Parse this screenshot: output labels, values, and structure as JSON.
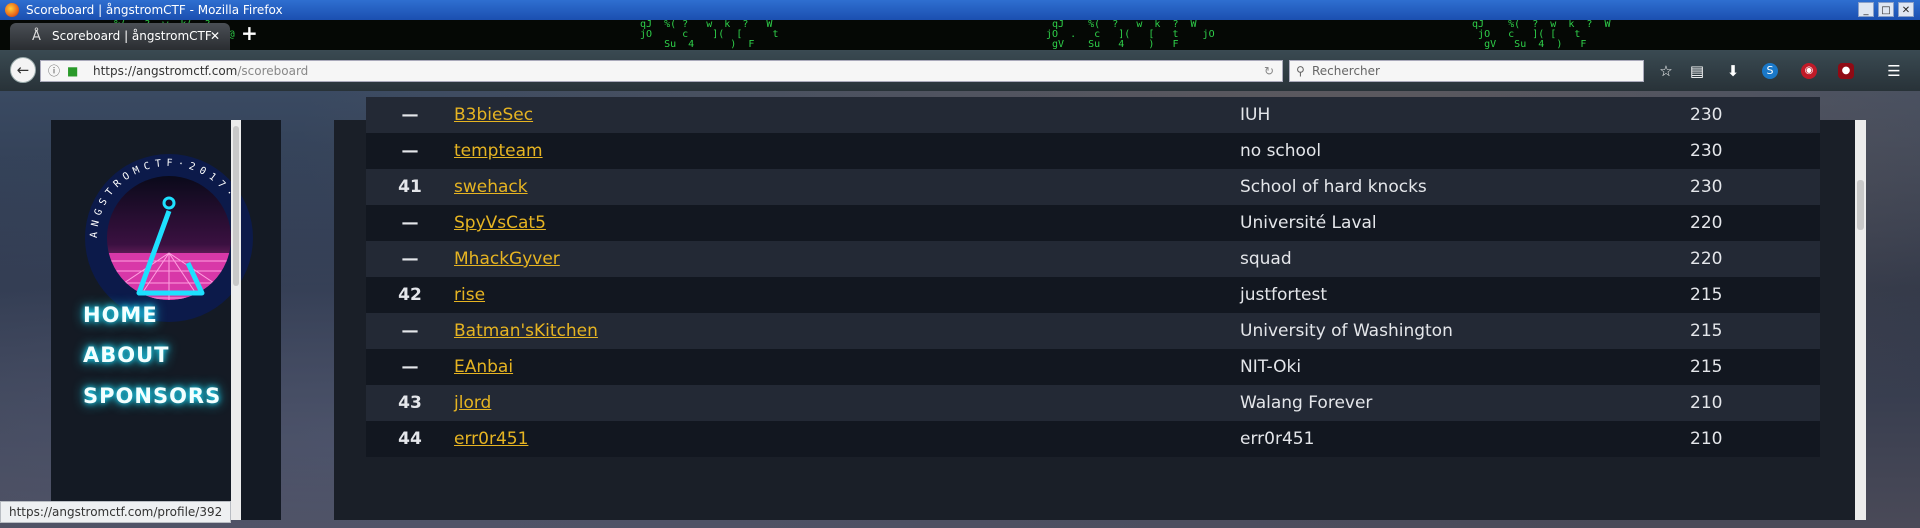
{
  "window": {
    "title": "Scoreboard | ångstromCTF - Mozilla Firefox",
    "controls": [
      "_",
      "□",
      "✕"
    ]
  },
  "tab": {
    "title": "Scoreboard | ångstromCTF",
    "favicon": "Å",
    "close": "✕",
    "new_tab": "+"
  },
  "navbar": {
    "back_icon": "arrow-left-icon",
    "url_domain": "https://angstromctf.com",
    "url_path": "/scoreboard",
    "search_placeholder": "Rechercher",
    "toolbar_icons": [
      "star-icon",
      "reading-list-icon",
      "download-icon",
      "skype-icon",
      "extension-icon",
      "ublock-icon",
      "menu-icon"
    ]
  },
  "sidebar": {
    "logo_text": "ANGSTROMCTF·2017·",
    "logo_glyph": "Å",
    "nav": [
      "HOME",
      "ABOUT",
      "SPONSORS"
    ]
  },
  "scoreboard": {
    "rows": [
      {
        "rank": "—",
        "team": "B3bieSec",
        "school": "IUH",
        "points": "230"
      },
      {
        "rank": "—",
        "team": "tempteam",
        "school": "no school",
        "points": "230"
      },
      {
        "rank": "41",
        "team": "swehack",
        "school": "School of hard knocks",
        "points": "230"
      },
      {
        "rank": "—",
        "team": "SpyVsCat5",
        "school": "Université Laval",
        "points": "220"
      },
      {
        "rank": "—",
        "team": "MhackGyver",
        "school": "squad",
        "points": "220"
      },
      {
        "rank": "42",
        "team": "rise",
        "school": "justfortest",
        "points": "215"
      },
      {
        "rank": "—",
        "team": "Batman'sKitchen",
        "school": "University of Washington",
        "points": "215"
      },
      {
        "rank": "—",
        "team": "EAnbai",
        "school": "NIT-Oki",
        "points": "215"
      },
      {
        "rank": "43",
        "team": "jlord",
        "school": "Walang Forever",
        "points": "210"
      },
      {
        "rank": "44",
        "team": "err0r451",
        "school": "err0r451",
        "points": "210"
      }
    ]
  },
  "statusbar": {
    "url": "https://angstromctf.com/profile/392"
  },
  "colors": {
    "link": "#e6b422",
    "neon": "#1ee0ff",
    "row_odd": "#232935",
    "row_even": "#121720"
  }
}
